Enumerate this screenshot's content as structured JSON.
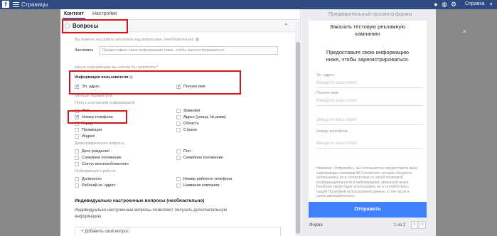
{
  "topbar": {
    "logo": "f",
    "pages_label": "Страницы",
    "help_label": "Справка",
    "caret": "▾"
  },
  "tabs": [
    {
      "label": "Контент"
    },
    {
      "label": "Настройки"
    }
  ],
  "questions": {
    "title": "Вопросы",
    "header_hint": "Вы можете настроить заголовок над вопросами. (Необязательно)",
    "header_label": "Заголовок",
    "header_placeholder": "Предоставьте свою информацию ниже, чтобы зарегистрироваться.",
    "ask_hint": "Какую информацию вы хотели бы запросить?",
    "user_info_title": "Информация пользователя",
    "user_info_options": [
      {
        "label": "Эл. адрес",
        "checked": true
      },
      {
        "label": "Полное имя",
        "checked": true
      }
    ],
    "fewer_params": "Меньше параметров",
    "contact_title": "Поля с контактной информацией",
    "contact_left": [
      {
        "label": "Имя",
        "checked": false
      },
      {
        "label": "Номер телефона",
        "checked": true
      },
      {
        "label": "Город",
        "checked": false
      },
      {
        "label": "Провинция",
        "checked": false
      },
      {
        "label": "Индекс",
        "checked": false
      }
    ],
    "contact_right": [
      {
        "label": "Фамилия",
        "checked": false
      },
      {
        "label": "Адрес (улица, № дома)",
        "checked": false
      },
      {
        "label": "Область",
        "checked": false
      },
      {
        "label": "Страна",
        "checked": false
      }
    ],
    "demographic_title": "Демографические вопросы",
    "demographic_left": [
      {
        "label": "Дата рождения",
        "checked": false
      },
      {
        "label": "Семейное положение",
        "checked": false
      },
      {
        "label": "Статус военнообязанного",
        "checked": false
      }
    ],
    "demographic_right": [
      {
        "label": "Пол",
        "checked": false
      },
      {
        "label": "Семейное положение",
        "checked": false
      }
    ],
    "work_title": "Информация о работе",
    "work_left": [
      {
        "label": "Должность",
        "checked": false
      },
      {
        "label": "Рабочий эл. адрес",
        "checked": false
      }
    ],
    "work_right": [
      {
        "label": "Номер рабочего телефона",
        "checked": false
      },
      {
        "label": "Названия компании",
        "checked": false
      }
    ],
    "custom_title": "Индивидуально настроенные вопросы (необязательно)",
    "custom_desc_1": "Индивидуально настроенные вопросы позволяют получать дополнительную",
    "custom_desc_2": "информацию.",
    "add_question": "+ Добавить свой вопрос"
  },
  "preview": {
    "title": "Предварительный просмотр формы",
    "headline_1": "Заказать тестовую рекламную",
    "headline_2": "кампанию",
    "subtitle_1": "Предоставьте свою информацию",
    "subtitle_2": "ниже, чтобы зарегистрироваться.",
    "fields": [
      {
        "label": "Эл. адрес",
        "placeholder": "Введите ваш ответ."
      },
      {
        "label": "Полное имя",
        "placeholder": "Введите ваш ответ."
      },
      {
        "label": "",
        "placeholder": "Введите ваш ответ."
      },
      {
        "label": "Номер телефона",
        "placeholder": "Введите ваш ответ."
      }
    ],
    "disclaimer": "Нажимая «Отправить», вы соглашаетесь предоставить вашу информацию компании MCConversion, которая обязуется использовать ее в соответствии со своей политикой конфиденциальности и информацией, указанной выше. Facebook также будет использовать ее в соответствии с нашей Политикой использования данных, в том числе в целях автоматического",
    "submit_label": "Отправить",
    "footer_label": "Форма",
    "footer_pages": "1 из 2",
    "prev_icon": "‹",
    "next_icon": "›"
  }
}
